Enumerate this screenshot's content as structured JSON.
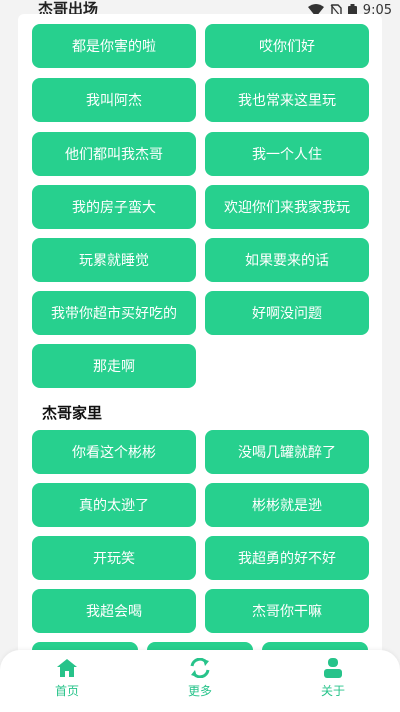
{
  "status_bar": {
    "title": "杰哥出场",
    "time": "9:05"
  },
  "colors": {
    "accent": "#27d08e",
    "nav_accent": "#27c38a"
  },
  "section1": {
    "buttons": [
      "都是你害的啦",
      "哎你们好",
      "我叫阿杰",
      "我也常来这里玩",
      "他们都叫我杰哥",
      "我一个人住",
      "我的房子蛮大",
      "欢迎你们来我家我玩",
      "玩累就睡觉",
      "如果要来的话",
      "我带你超市买好吃的",
      "好啊没问题",
      "那走啊"
    ]
  },
  "section2": {
    "title": "杰哥家里",
    "buttons": [
      "你看这个彬彬",
      "没喝几罐就醉了",
      "真的太逊了",
      "彬彬就是逊",
      "开玩笑",
      "我超勇的好不好",
      "我超会喝",
      "杰哥你干嘛"
    ]
  },
  "bottom_nav": {
    "items": [
      {
        "label": "首页",
        "icon": "home-icon"
      },
      {
        "label": "更多",
        "icon": "refresh-icon"
      },
      {
        "label": "关于",
        "icon": "user-icon"
      }
    ]
  }
}
